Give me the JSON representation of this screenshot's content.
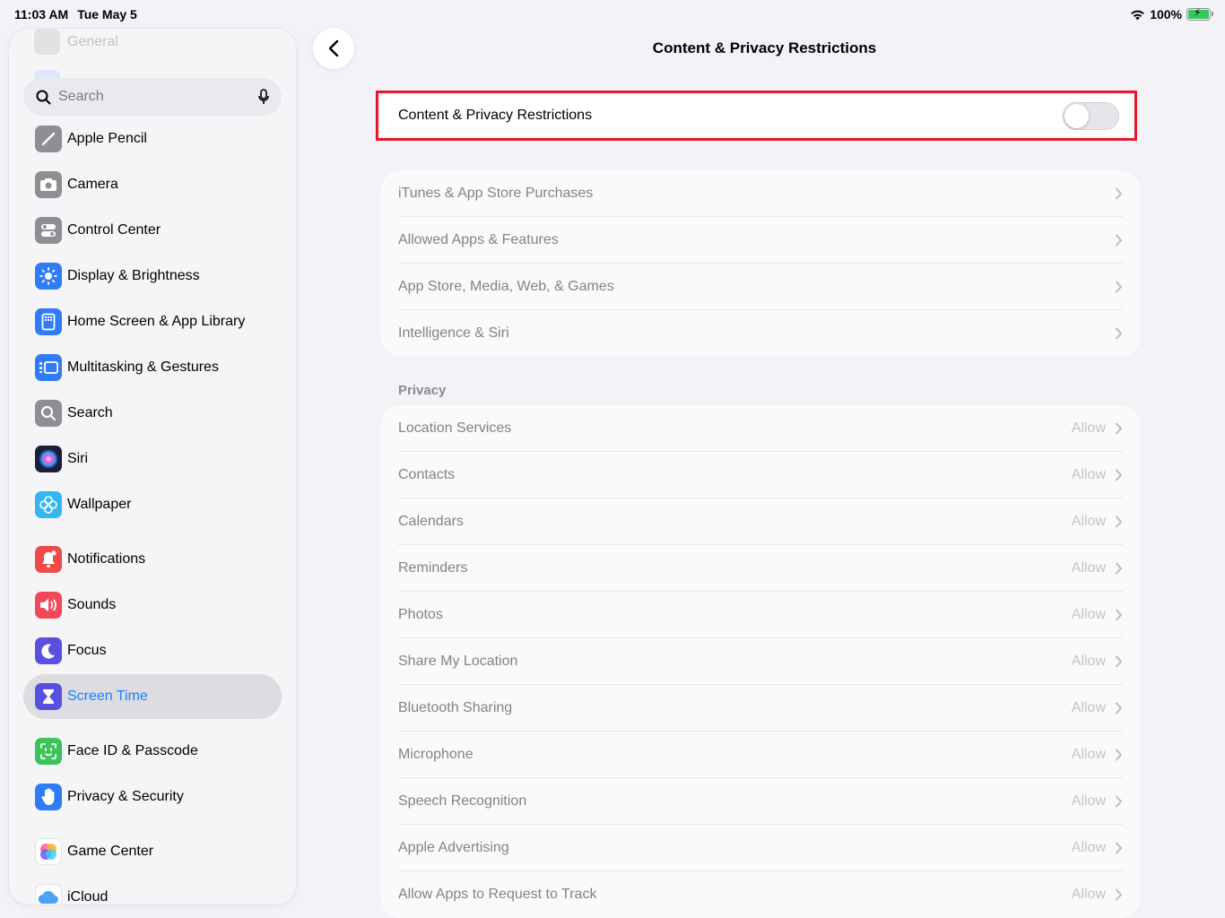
{
  "status_bar": {
    "time": "11:03 AM",
    "date": "Tue May 5",
    "battery": "100%"
  },
  "sidebar": {
    "faded_label": "General",
    "search_placeholder": "Search",
    "items": [
      {
        "label": "Apple Pencil",
        "icon": "apple-pencil-icon",
        "color": "#8e8e93"
      },
      {
        "label": "Camera",
        "icon": "camera-icon",
        "color": "#8e8e93"
      },
      {
        "label": "Control Center",
        "icon": "control-center-icon",
        "color": "#8e8e93"
      },
      {
        "label": "Display & Brightness",
        "icon": "sun-icon",
        "color": "#2f7cf6"
      },
      {
        "label": "Home Screen & App Library",
        "icon": "home-screen-icon",
        "color": "#2f7cf6"
      },
      {
        "label": "Multitasking & Gestures",
        "icon": "multitasking-icon",
        "color": "#2f7cf6"
      },
      {
        "label": "Search",
        "icon": "search-icon",
        "color": "#8e8e93"
      },
      {
        "label": "Siri",
        "icon": "siri-icon",
        "color": "#1c1c3c"
      },
      {
        "label": "Wallpaper",
        "icon": "wallpaper-icon",
        "color": "#35b6f0"
      },
      {
        "label": "Notifications",
        "icon": "bell-icon",
        "color": "#f04a4a"
      },
      {
        "label": "Sounds",
        "icon": "speaker-icon",
        "color": "#f04a5a"
      },
      {
        "label": "Focus",
        "icon": "moon-icon",
        "color": "#5a4fe0"
      },
      {
        "label": "Screen Time",
        "icon": "hourglass-icon",
        "color": "#5a4fe0"
      },
      {
        "label": "Face ID & Passcode",
        "icon": "face-id-icon",
        "color": "#3bc45a"
      },
      {
        "label": "Privacy & Security",
        "icon": "hand-icon",
        "color": "#2f7cf6"
      },
      {
        "label": "Game Center",
        "icon": "game-center-icon",
        "color": "#ffffff"
      },
      {
        "label": "iCloud",
        "icon": "icloud-icon",
        "color": "#ffffff"
      }
    ]
  },
  "main": {
    "title": "Content & Privacy Restrictions",
    "toggle": {
      "label": "Content & Privacy Restrictions",
      "on": false
    },
    "group1": [
      {
        "label": "iTunes & App Store Purchases"
      },
      {
        "label": "Allowed Apps & Features"
      },
      {
        "label": "App Store, Media, Web, & Games"
      },
      {
        "label": "Intelligence & Siri"
      }
    ],
    "privacy_header": "Privacy",
    "privacy": [
      {
        "label": "Location Services",
        "value": "Allow"
      },
      {
        "label": "Contacts",
        "value": "Allow"
      },
      {
        "label": "Calendars",
        "value": "Allow"
      },
      {
        "label": "Reminders",
        "value": "Allow"
      },
      {
        "label": "Photos",
        "value": "Allow"
      },
      {
        "label": "Share My Location",
        "value": "Allow"
      },
      {
        "label": "Bluetooth Sharing",
        "value": "Allow"
      },
      {
        "label": "Microphone",
        "value": "Allow"
      },
      {
        "label": "Speech Recognition",
        "value": "Allow"
      },
      {
        "label": "Apple Advertising",
        "value": "Allow"
      },
      {
        "label": "Allow Apps to Request to Track",
        "value": "Allow"
      }
    ]
  },
  "colors": {
    "accent": "#1a80ff",
    "highlight": "#e3182a"
  }
}
